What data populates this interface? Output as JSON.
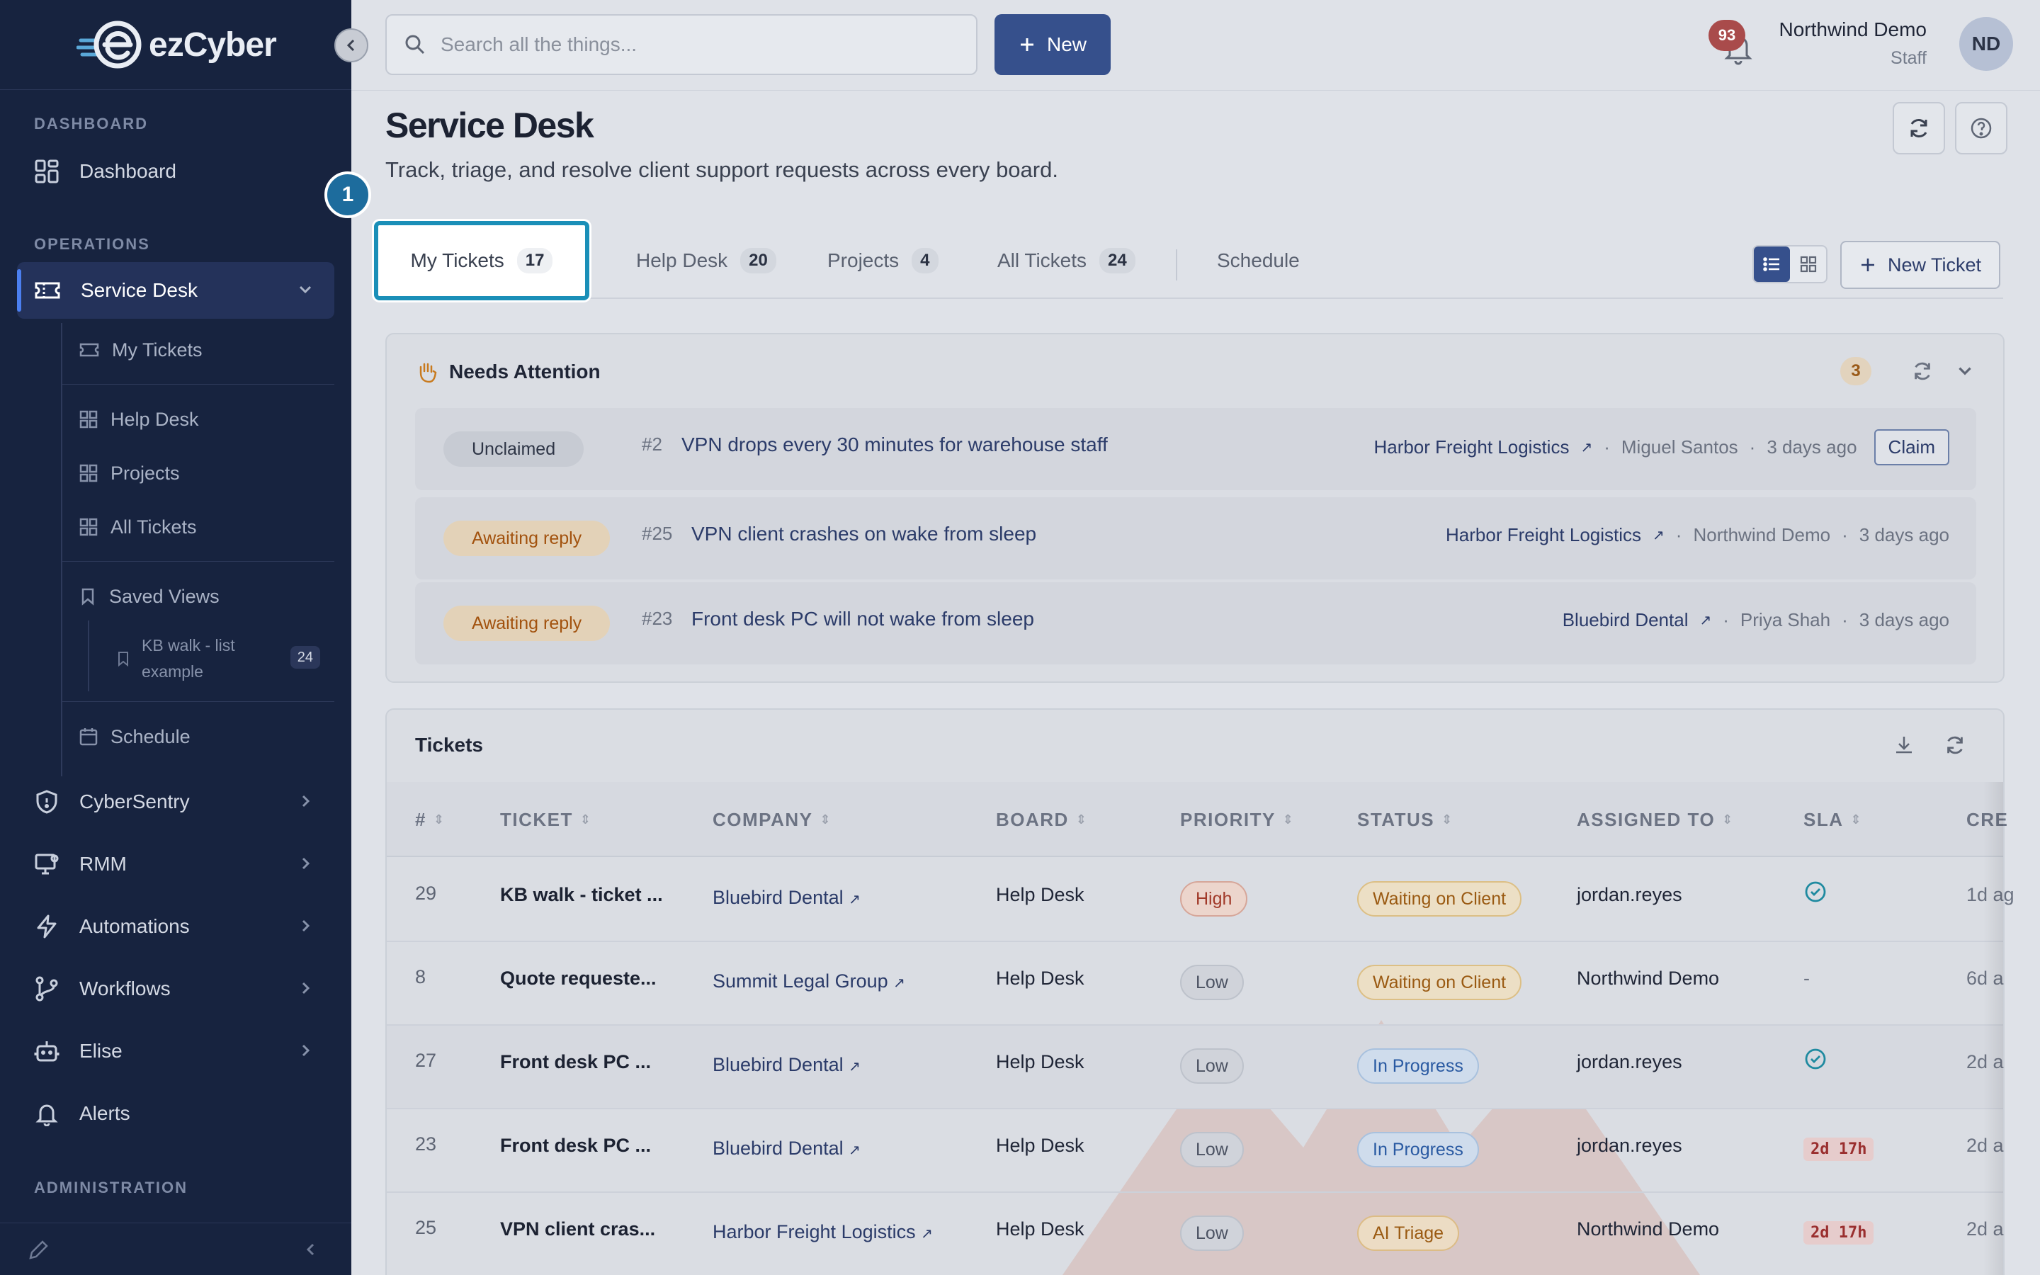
{
  "app": {
    "brand": "ezCyber"
  },
  "sidebar": {
    "sections": {
      "dashboard": "DASHBOARD",
      "operations": "OPERATIONS",
      "administration": "ADMINISTRATION"
    },
    "dashboard": "Dashboard",
    "service_desk": "Service Desk",
    "sub_items": {
      "my_tickets": "My Tickets",
      "help_desk": "Help Desk",
      "projects": "Projects",
      "all_tickets": "All Tickets",
      "saved_views": "Saved Views",
      "saved_view_name": "KB walk - list example",
      "saved_view_count": "24",
      "schedule": "Schedule"
    },
    "items": {
      "cybersentry": "CyberSentry",
      "rmm": "RMM",
      "automations": "Automations",
      "workflows": "Workflows",
      "elise": "Elise",
      "alerts": "Alerts"
    }
  },
  "topbar": {
    "search_placeholder": "Search all the things...",
    "new_label": "New",
    "notification_count": "93",
    "user_name": "Northwind Demo",
    "user_role": "Staff",
    "avatar_initials": "ND"
  },
  "page": {
    "title": "Service Desk",
    "subtitle": "Track, triage, and resolve client support requests across every board.",
    "step_badge": "1"
  },
  "tabs": [
    {
      "label": "My Tickets",
      "count": "17"
    },
    {
      "label": "Help Desk",
      "count": "20"
    },
    {
      "label": "Projects",
      "count": "4"
    },
    {
      "label": "All Tickets",
      "count": "24"
    },
    {
      "label": "Schedule"
    }
  ],
  "new_ticket_label": "New Ticket",
  "needs_attention": {
    "title": "Needs Attention",
    "count": "3",
    "items": [
      {
        "status": "Unclaimed",
        "num": "#2",
        "title": "VPN drops every 30 minutes for warehouse staff",
        "company": "Harbor Freight Logistics",
        "person": "Miguel Santos",
        "when": "3 days ago",
        "action": "Claim"
      },
      {
        "status": "Awaiting reply",
        "num": "#25",
        "title": "VPN client crashes on wake from sleep",
        "company": "Harbor Freight Logistics",
        "person": "Northwind Demo",
        "when": "3 days ago"
      },
      {
        "status": "Awaiting reply",
        "num": "#23",
        "title": "Front desk PC will not wake from sleep",
        "company": "Bluebird Dental",
        "person": "Priya Shah",
        "when": "3 days ago"
      }
    ]
  },
  "tickets": {
    "title": "Tickets",
    "columns": [
      "#",
      "TICKET",
      "COMPANY",
      "BOARD",
      "PRIORITY",
      "STATUS",
      "ASSIGNED TO",
      "SLA",
      "CRE"
    ],
    "rows": [
      {
        "num": "29",
        "ticket": "KB walk - ticket ...",
        "company": "Bluebird Dental",
        "board": "Help Desk",
        "priority": "High",
        "status": "Waiting on Client",
        "assigned": "jordan.reyes",
        "sla": "check",
        "created": "1d ag"
      },
      {
        "num": "8",
        "ticket": "Quote requeste...",
        "company": "Summit Legal Group",
        "board": "Help Desk",
        "priority": "Low",
        "status": "Waiting on Client",
        "assigned": "Northwind Demo",
        "sla": "-",
        "created": "6d a"
      },
      {
        "num": "27",
        "ticket": "Front desk PC ...",
        "company": "Bluebird Dental",
        "board": "Help Desk",
        "priority": "Low",
        "status": "In Progress",
        "assigned": "jordan.reyes",
        "sla": "check",
        "created": "2d a"
      },
      {
        "num": "23",
        "ticket": "Front desk PC ...",
        "company": "Bluebird Dental",
        "board": "Help Desk",
        "priority": "Low",
        "status": "In Progress",
        "assigned": "jordan.reyes",
        "sla": "2d 17h",
        "created": "2d a"
      },
      {
        "num": "25",
        "ticket": "VPN client cras...",
        "company": "Harbor Freight Logistics",
        "board": "Help Desk",
        "priority": "Low",
        "status": "AI Triage",
        "assigned": "Northwind Demo",
        "sla": "2d 17h",
        "created": "2d a"
      }
    ]
  },
  "colors": {
    "sidebar_bg": "#17233f",
    "primary": "#36508c",
    "tab_highlight": "#1a8fb8"
  }
}
